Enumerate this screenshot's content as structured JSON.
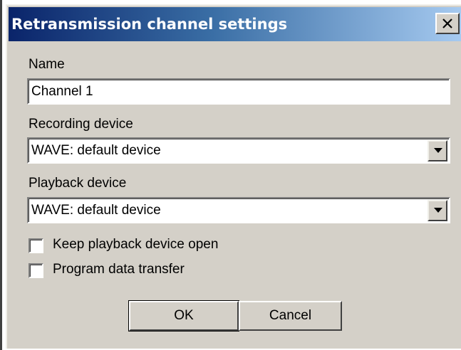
{
  "window": {
    "title": "Retransmission channel settings",
    "close_symbol": "×",
    "close_icon": "close-icon"
  },
  "name_field": {
    "label": "Name",
    "value": "Channel 1"
  },
  "recording_device": {
    "label": "Recording device",
    "value": "WAVE: default device",
    "icon": "chevron-down-icon"
  },
  "playback_device": {
    "label": "Playback device",
    "value": "WAVE: default device",
    "icon": "chevron-down-icon"
  },
  "options": {
    "keep_open": {
      "label": "Keep playback device open",
      "checked": false
    },
    "program_data": {
      "label": "Program data transfer",
      "checked": false
    }
  },
  "buttons": {
    "ok_label": "OK",
    "cancel_label": "Cancel"
  },
  "colors": {
    "face": "#d4d0c8",
    "title_start": "#0a246a",
    "title_end": "#a6caf0",
    "title_text": "#ffffff"
  }
}
